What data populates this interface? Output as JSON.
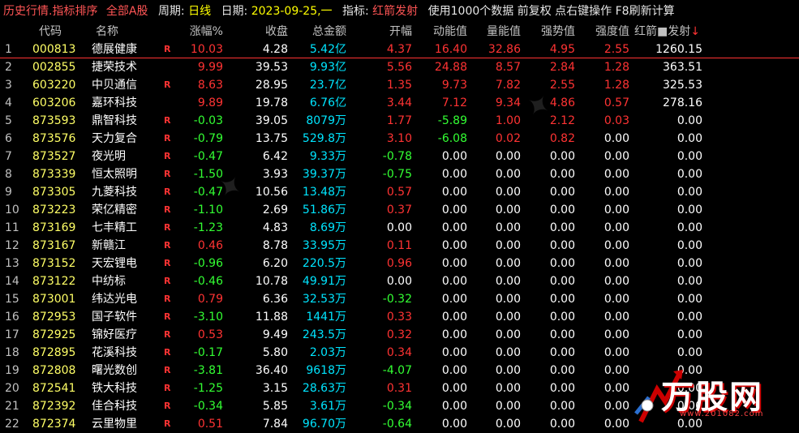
{
  "topbar": {
    "title": "历史行情.指标排序",
    "scope": "全部A股",
    "period_label": "周期:",
    "period_value": "日线",
    "date_label": "日期:",
    "date_value": "2023-09-25,一",
    "indicator_label": "指标:",
    "indicator_value": "红箭发射",
    "note": "使用1000个数据 前复权 点右键操作 F8刷新计算"
  },
  "columns": {
    "code": "代码",
    "name": "名称",
    "chg": "涨幅%",
    "close": "收盘",
    "amount": "总金额",
    "open": "开幅",
    "dong": "动能值",
    "liang": "量能值",
    "qiang": "强势值",
    "qd": "强度值",
    "hj": "红箭■发射",
    "sort_arrow": "↓"
  },
  "rows": [
    {
      "idx": "1",
      "code": "000813",
      "name": "德展健康",
      "r": "R",
      "chg": "10.03",
      "close": "4.28",
      "amount": "5.42亿",
      "open": "4.37",
      "dong": "16.40",
      "liang": "32.86",
      "qiang": "4.95",
      "qd": "2.55",
      "hj": "1260.15"
    },
    {
      "idx": "2",
      "code": "002855",
      "name": "捷荣技术",
      "r": "",
      "chg": "9.99",
      "close": "39.53",
      "amount": "9.93亿",
      "open": "5.56",
      "dong": "24.88",
      "liang": "8.57",
      "qiang": "2.84",
      "qd": "1.28",
      "hj": "363.51"
    },
    {
      "idx": "3",
      "code": "603220",
      "name": "中贝通信",
      "r": "R",
      "chg": "8.63",
      "close": "28.95",
      "amount": "23.7亿",
      "open": "1.35",
      "dong": "9.73",
      "liang": "7.82",
      "qiang": "2.55",
      "qd": "1.28",
      "hj": "325.53"
    },
    {
      "idx": "4",
      "code": "603206",
      "name": "嘉环科技",
      "r": "",
      "chg": "9.89",
      "close": "19.78",
      "amount": "6.76亿",
      "open": "3.44",
      "dong": "7.12",
      "liang": "9.34",
      "qiang": "4.86",
      "qd": "0.57",
      "hj": "278.16"
    },
    {
      "idx": "5",
      "code": "873593",
      "name": "鼎智科技",
      "r": "R",
      "chg": "-0.03",
      "close": "39.05",
      "amount": "8079万",
      "open": "1.77",
      "dong": "-5.89",
      "liang": "1.00",
      "qiang": "2.12",
      "qd": "0.03",
      "hj": "0.00"
    },
    {
      "idx": "6",
      "code": "873576",
      "name": "天力复合",
      "r": "R",
      "chg": "-0.79",
      "close": "13.75",
      "amount": "529.8万",
      "open": "3.10",
      "dong": "-6.08",
      "liang": "0.02",
      "qiang": "0.82",
      "qd": "0.00",
      "hj": "0.00"
    },
    {
      "idx": "7",
      "code": "873527",
      "name": "夜光明",
      "r": "R",
      "chg": "-0.47",
      "close": "6.42",
      "amount": "9.33万",
      "open": "-0.78",
      "dong": "0.00",
      "liang": "0.00",
      "qiang": "0.00",
      "qd": "0.00",
      "hj": "0.00"
    },
    {
      "idx": "8",
      "code": "873339",
      "name": "恒太照明",
      "r": "R",
      "chg": "-1.50",
      "close": "3.93",
      "amount": "39.37万",
      "open": "-0.75",
      "dong": "0.00",
      "liang": "0.00",
      "qiang": "0.00",
      "qd": "0.00",
      "hj": "0.00"
    },
    {
      "idx": "9",
      "code": "873305",
      "name": "九菱科技",
      "r": "R",
      "chg": "-0.47",
      "close": "10.56",
      "amount": "13.48万",
      "open": "0.57",
      "dong": "0.00",
      "liang": "0.00",
      "qiang": "0.00",
      "qd": "0.00",
      "hj": "0.00"
    },
    {
      "idx": "10",
      "code": "873223",
      "name": "荣亿精密",
      "r": "R",
      "chg": "-1.10",
      "close": "2.69",
      "amount": "51.86万",
      "open": "0.37",
      "dong": "0.00",
      "liang": "0.00",
      "qiang": "0.00",
      "qd": "0.00",
      "hj": "0.00"
    },
    {
      "idx": "11",
      "code": "873169",
      "name": "七丰精工",
      "r": "R",
      "chg": "-1.23",
      "close": "4.83",
      "amount": "8.69万",
      "open": "0.00",
      "dong": "0.00",
      "liang": "0.00",
      "qiang": "0.00",
      "qd": "0.00",
      "hj": "0.00"
    },
    {
      "idx": "12",
      "code": "873167",
      "name": "新赣江",
      "r": "R",
      "chg": "0.46",
      "close": "8.78",
      "amount": "33.95万",
      "open": "0.11",
      "dong": "0.00",
      "liang": "0.00",
      "qiang": "0.00",
      "qd": "0.00",
      "hj": "0.00"
    },
    {
      "idx": "13",
      "code": "873152",
      "name": "天宏锂电",
      "r": "R",
      "chg": "-0.96",
      "close": "6.20",
      "amount": "220.5万",
      "open": "0.96",
      "dong": "0.00",
      "liang": "0.00",
      "qiang": "0.00",
      "qd": "0.00",
      "hj": "0.00"
    },
    {
      "idx": "14",
      "code": "873122",
      "name": "中纺标",
      "r": "R",
      "chg": "-0.46",
      "close": "10.78",
      "amount": "49.91万",
      "open": "0.00",
      "dong": "0.00",
      "liang": "0.00",
      "qiang": "0.00",
      "qd": "0.00",
      "hj": "0.00"
    },
    {
      "idx": "15",
      "code": "873001",
      "name": "纬达光电",
      "r": "R",
      "chg": "0.79",
      "close": "6.36",
      "amount": "32.53万",
      "open": "-0.32",
      "dong": "0.00",
      "liang": "0.00",
      "qiang": "0.00",
      "qd": "0.00",
      "hj": "0.00"
    },
    {
      "idx": "16",
      "code": "872953",
      "name": "国子软件",
      "r": "R",
      "chg": "-3.10",
      "close": "11.88",
      "amount": "1441万",
      "open": "0.33",
      "dong": "0.00",
      "liang": "0.00",
      "qiang": "0.00",
      "qd": "0.00",
      "hj": "0.00"
    },
    {
      "idx": "17",
      "code": "872925",
      "name": "锦好医疗",
      "r": "R",
      "chg": "0.53",
      "close": "9.49",
      "amount": "243.5万",
      "open": "0.32",
      "dong": "0.00",
      "liang": "0.00",
      "qiang": "0.00",
      "qd": "0.00",
      "hj": "0.00"
    },
    {
      "idx": "18",
      "code": "872895",
      "name": "花溪科技",
      "r": "R",
      "chg": "-0.17",
      "close": "5.80",
      "amount": "2.03万",
      "open": "0.34",
      "dong": "0.00",
      "liang": "0.00",
      "qiang": "0.00",
      "qd": "0.00",
      "hj": "0.00"
    },
    {
      "idx": "19",
      "code": "872808",
      "name": "曙光数创",
      "r": "R",
      "chg": "-3.81",
      "close": "36.40",
      "amount": "9618万",
      "open": "-4.07",
      "dong": "0.00",
      "liang": "0.00",
      "qiang": "0.00",
      "qd": "0.00",
      "hj": "0.00"
    },
    {
      "idx": "20",
      "code": "872541",
      "name": "铁大科技",
      "r": "R",
      "chg": "-1.25",
      "close": "3.15",
      "amount": "28.63万",
      "open": "0.31",
      "dong": "0.00",
      "liang": "0.00",
      "qiang": "0.00",
      "qd": "0.00",
      "hj": "0.00"
    },
    {
      "idx": "21",
      "code": "872392",
      "name": "佳合科技",
      "r": "R",
      "chg": "-0.34",
      "close": "5.85",
      "amount": "3.61万",
      "open": "-0.34",
      "dong": "0.00",
      "liang": "0.00",
      "qiang": "0.00",
      "qd": "0.00",
      "hj": "0.00"
    },
    {
      "idx": "22",
      "code": "872374",
      "name": "云里物里",
      "r": "R",
      "chg": "0.51",
      "close": "7.84",
      "amount": "96.70万",
      "open": "-0.64",
      "dong": "0.00",
      "liang": "0.00",
      "qiang": "0.00",
      "qd": "0.00",
      "hj": "0.00"
    }
  ],
  "logo": {
    "text": "万股网",
    "url": "www.201082.com"
  },
  "colors": {
    "up": "#ff3333",
    "down": "#33ff33",
    "code": "#ffff66",
    "amount": "#00e5ff",
    "background": "#000000"
  }
}
